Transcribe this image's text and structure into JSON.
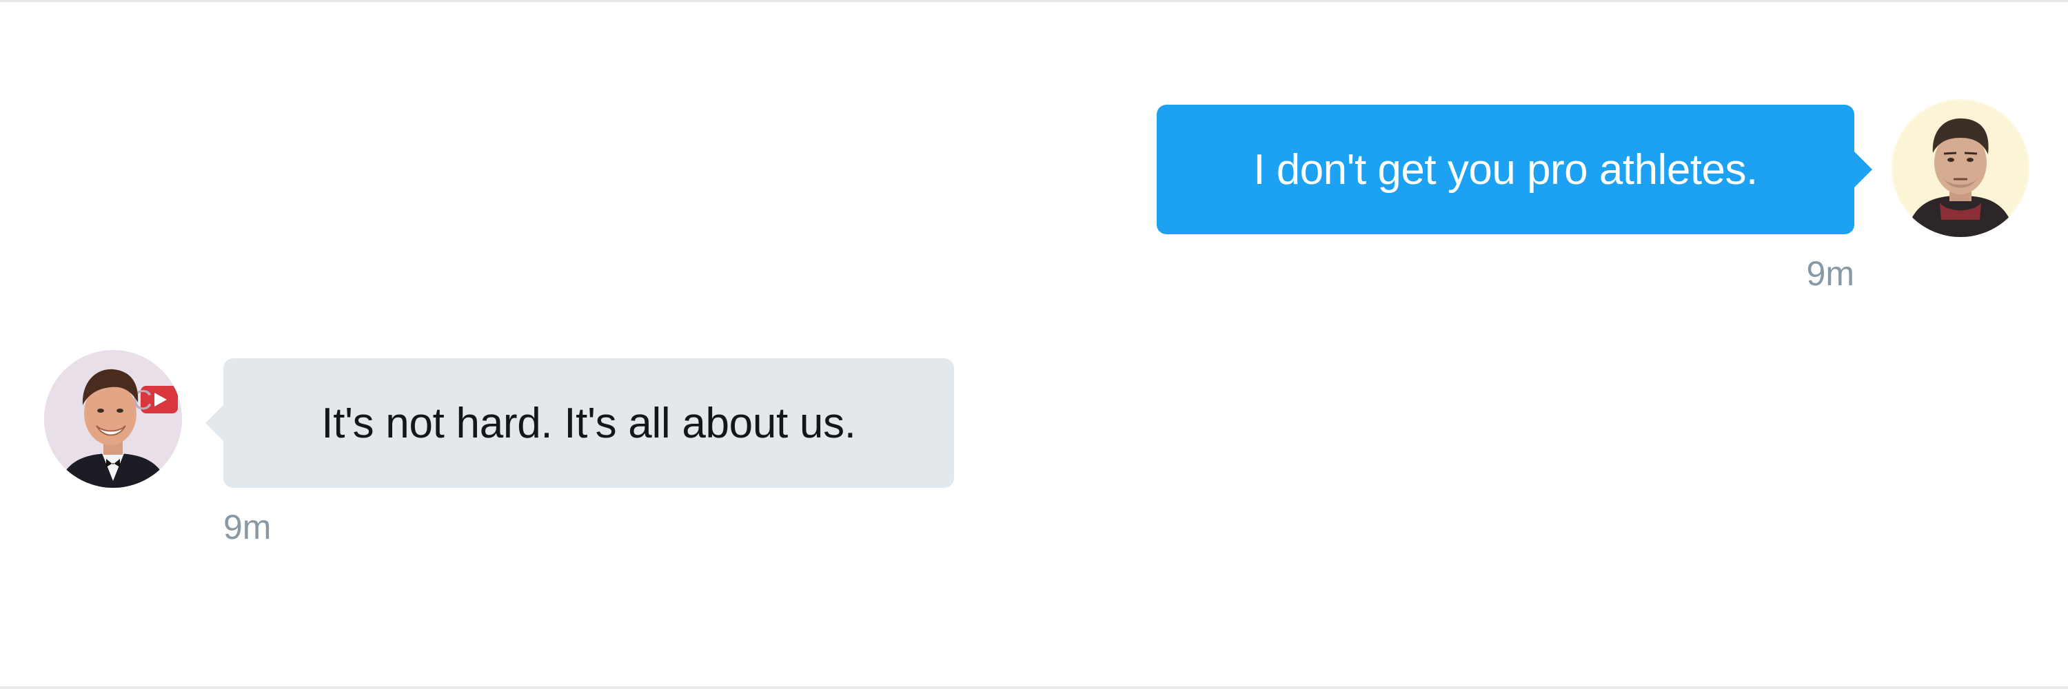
{
  "conversation": {
    "messages": [
      {
        "direction": "outgoing",
        "text": "I don't get you pro athletes.",
        "time": "9m",
        "bubble_color": "#1da1f2",
        "avatar_icon": "user-avatar-icon"
      },
      {
        "direction": "incoming",
        "text": "It's not hard. It's all about us.",
        "time": "9m",
        "bubble_color": "#e3e8ed",
        "avatar_icon": "contact-avatar-icon"
      }
    ]
  },
  "colors": {
    "accent": "#1da1f2",
    "incoming_bubble": "#e3e8ed",
    "timestamp": "#8899a6"
  }
}
